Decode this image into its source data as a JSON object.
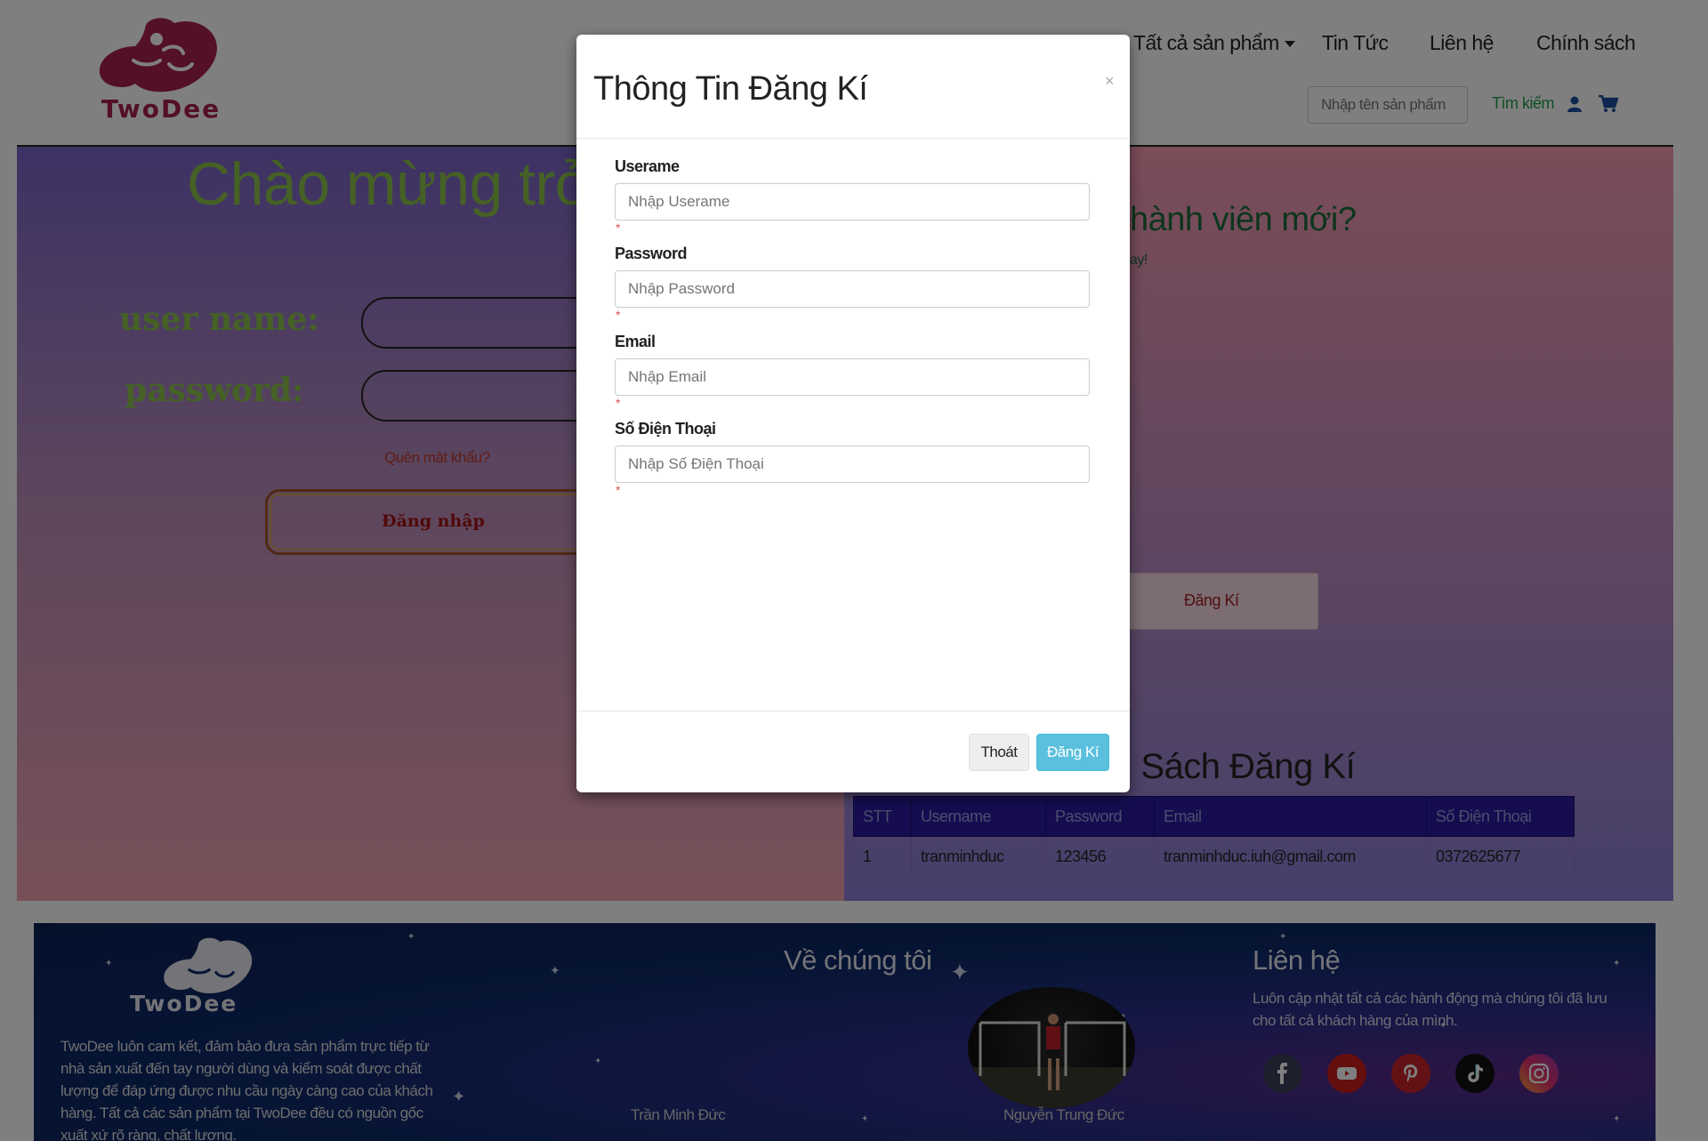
{
  "brand": {
    "name": "TwoDee"
  },
  "nav": {
    "items": [
      "Tất cả sản phẩm",
      "Tin Tức",
      "Liên hệ",
      "Chính sách"
    ],
    "search_placeholder": "Nhập tên sản phẩm",
    "search_label": "Tìm kiếm"
  },
  "login": {
    "welcome": "Chào mừng trở",
    "username_label": "user name:",
    "password_label": "password:",
    "forgot": "Quên mật khẩu?",
    "button": "Đăng nhập"
  },
  "register": {
    "question": "hành viên mới?",
    "subtext": "ay!",
    "button": "Đăng Kí",
    "list_title": "h Sách Đăng Kí"
  },
  "table": {
    "headers": [
      "STT",
      "Username",
      "Password",
      "Email",
      "Số Điện Thoại"
    ],
    "rows": [
      [
        "1",
        "tranminhduc",
        "123456",
        "tranminhduc.iuh@gmail.com",
        "0372625677"
      ]
    ]
  },
  "modal": {
    "title": "Thông Tin Đăng Kí",
    "close": "×",
    "required_mark": "*",
    "fields": [
      {
        "label": "Userame",
        "placeholder": "Nhập Userame"
      },
      {
        "label": "Password",
        "placeholder": "Nhập Password"
      },
      {
        "label": "Email",
        "placeholder": "Nhập Email"
      },
      {
        "label": "Số Điện Thoại",
        "placeholder": "Nhập Số Điện Thoại"
      }
    ],
    "cancel_button": "Thoát",
    "submit_button": "Đăng Kí"
  },
  "footer": {
    "brand": "TwoDee",
    "description": "TwoDee luôn cam kết, đảm bảo đưa sản phẩm trực tiếp từ nhà sản xuất đến tay người dùng và kiểm soát được chất lượng để đáp ứng được nhu cầu ngày càng cao của khách hàng. Tất cả các sản phẩm tại TwoDee đều có nguồn gốc xuất xứ rõ ràng, chất lượng.",
    "about_title": "Về chúng tôi",
    "members": [
      "Trần Minh Đức",
      "Nguyễn Trung Đức"
    ],
    "contact_title": "Liên hệ",
    "contact_desc": "Luôn cập nhật tất cả các hành động mà chúng tôi đã lưu cho tất cả khách hàng của mình.",
    "social": [
      "facebook-icon",
      "youtube-icon",
      "pinterest-icon",
      "tiktok-icon",
      "instagram-icon"
    ]
  },
  "colors": {
    "accent": "#5bc0de",
    "brand": "#a8204f",
    "link": "#1e9c4a"
  }
}
